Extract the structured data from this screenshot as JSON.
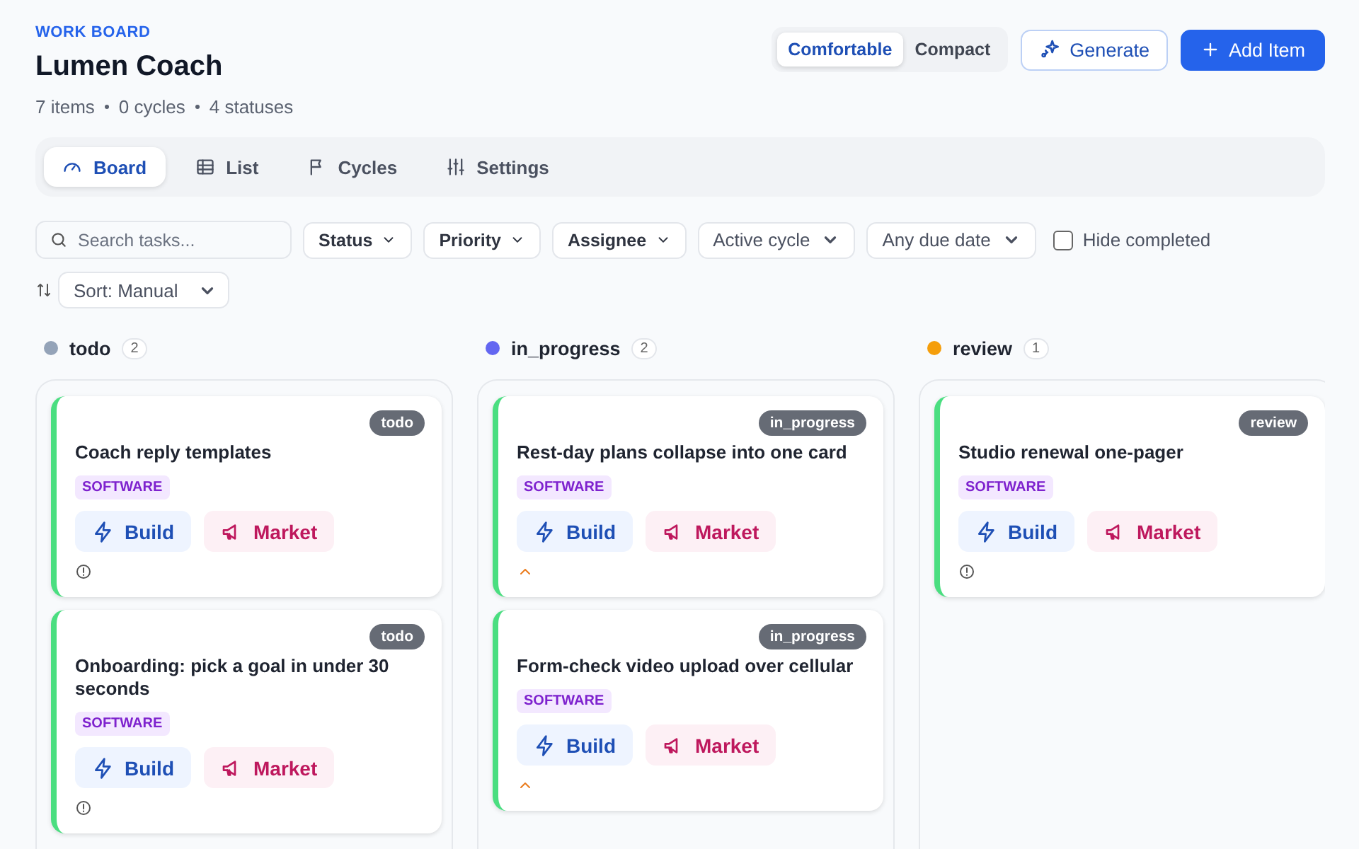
{
  "header": {
    "eyebrow": "WORK BOARD",
    "title": "Lumen Coach",
    "meta": [
      "7 items",
      "0 cycles",
      "4 statuses"
    ]
  },
  "density": [
    {
      "label": "Comfortable",
      "selected": true
    },
    {
      "label": "Compact",
      "selected": false
    }
  ],
  "actions": {
    "generate": "Generate",
    "add": "Add Item"
  },
  "tabs": [
    {
      "label": "Board",
      "selected": true
    },
    {
      "label": "List",
      "selected": false
    },
    {
      "label": "Cycles",
      "selected": false
    },
    {
      "label": "Settings",
      "selected": false
    }
  ],
  "filters": {
    "search": {
      "placeholder": "Search tasks..."
    },
    "menus": [
      "Status",
      "Priority",
      "Assignee"
    ],
    "selects": [
      "Active cycle",
      "Any due date"
    ],
    "hide_completed": {
      "label": "Hide completed",
      "checked": false
    },
    "sort": "Sort: Manual"
  },
  "columns": [
    {
      "name": "todo",
      "count": "2",
      "color": "#94a3b8",
      "cards": [
        {
          "status": "todo",
          "title": "Coach reply templates",
          "tag": "SOFTWARE",
          "actions": [
            "Build",
            "Market"
          ],
          "kind": "none"
        },
        {
          "status": "todo",
          "title": "Onboarding: pick a goal in under 30 seconds",
          "tag": "SOFTWARE",
          "actions": [
            "Build",
            "Market"
          ],
          "kind": "none"
        }
      ]
    },
    {
      "name": "in_progress",
      "count": "2",
      "color": "#6366f1",
      "cards": [
        {
          "status": "in_progress",
          "title": "Rest-day plans collapse into one card",
          "tag": "SOFTWARE",
          "actions": [
            "Build",
            "Market"
          ],
          "kind": "medium"
        },
        {
          "status": "in_progress",
          "title": "Form-check video upload over cellular",
          "tag": "SOFTWARE",
          "actions": [
            "Build",
            "Market"
          ],
          "kind": "medium"
        }
      ]
    },
    {
      "name": "review",
      "count": "1",
      "color": "#f59e0b",
      "cards": [
        {
          "status": "review",
          "title": "Studio renewal one-pager",
          "tag": "SOFTWARE",
          "actions": [
            "Build",
            "Market"
          ],
          "kind": "none"
        }
      ]
    }
  ]
}
